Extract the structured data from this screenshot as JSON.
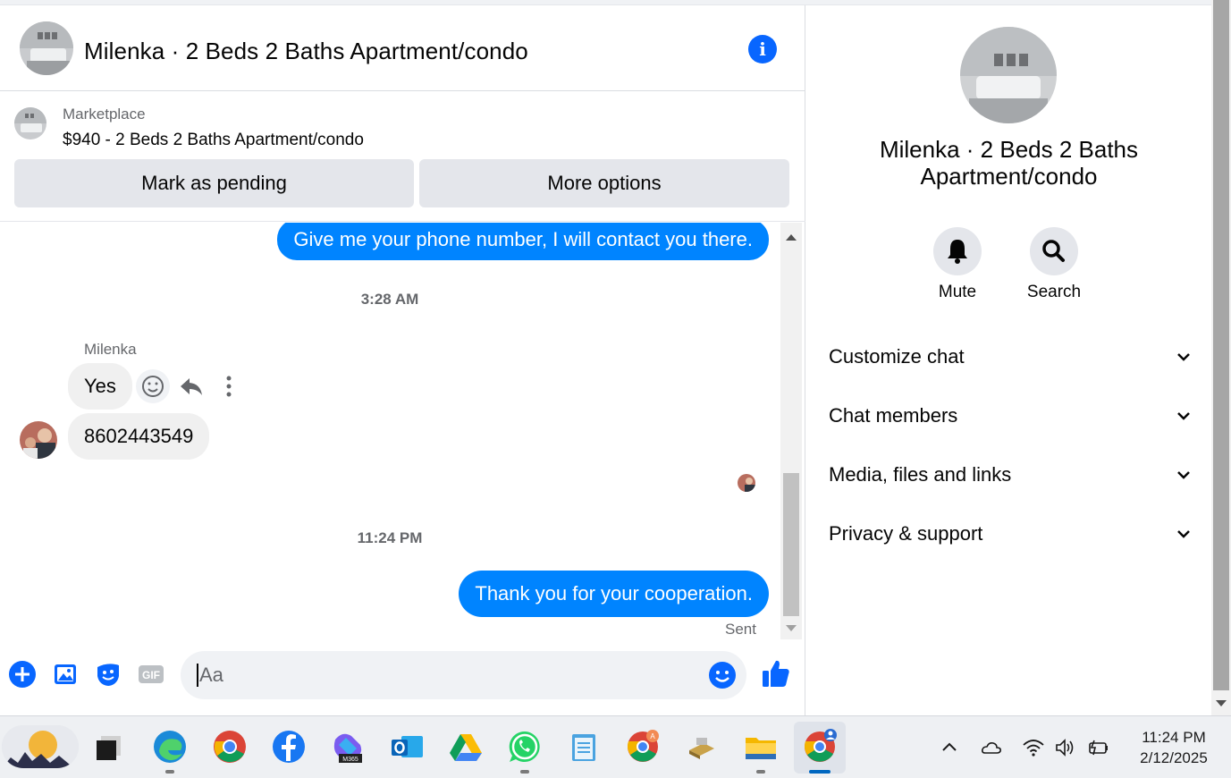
{
  "chat": {
    "title": "Milenka · 2 Beds 2 Baths Apartment/condo",
    "marketplace_label": "Marketplace",
    "listing": "$940 - 2 Beds 2 Baths Apartment/condo",
    "mark_pending_label": "Mark as pending",
    "more_options_label": "More options"
  },
  "messages": {
    "out_1": "Give me your phone number, I will contact you there.",
    "timestamp_1": "3:28 AM",
    "sender": "Milenka",
    "in_1": "Yes",
    "in_2": "8602443549",
    "timestamp_2": "11:24 PM",
    "out_2": "Thank you for your cooperation.",
    "sent_status": "Sent"
  },
  "composer": {
    "placeholder": "Aa"
  },
  "info_panel": {
    "name": "Milenka · 2 Beds 2 Baths Apartment/condo",
    "mute_label": "Mute",
    "search_label": "Search",
    "sections": [
      "Customize chat",
      "Chat members",
      "Media, files and links",
      "Privacy & support"
    ]
  },
  "taskbar": {
    "time": "11:24 PM",
    "date": "2/12/2025"
  },
  "colors": {
    "accent": "#0084ff",
    "brand_blue": "#0866ff"
  }
}
